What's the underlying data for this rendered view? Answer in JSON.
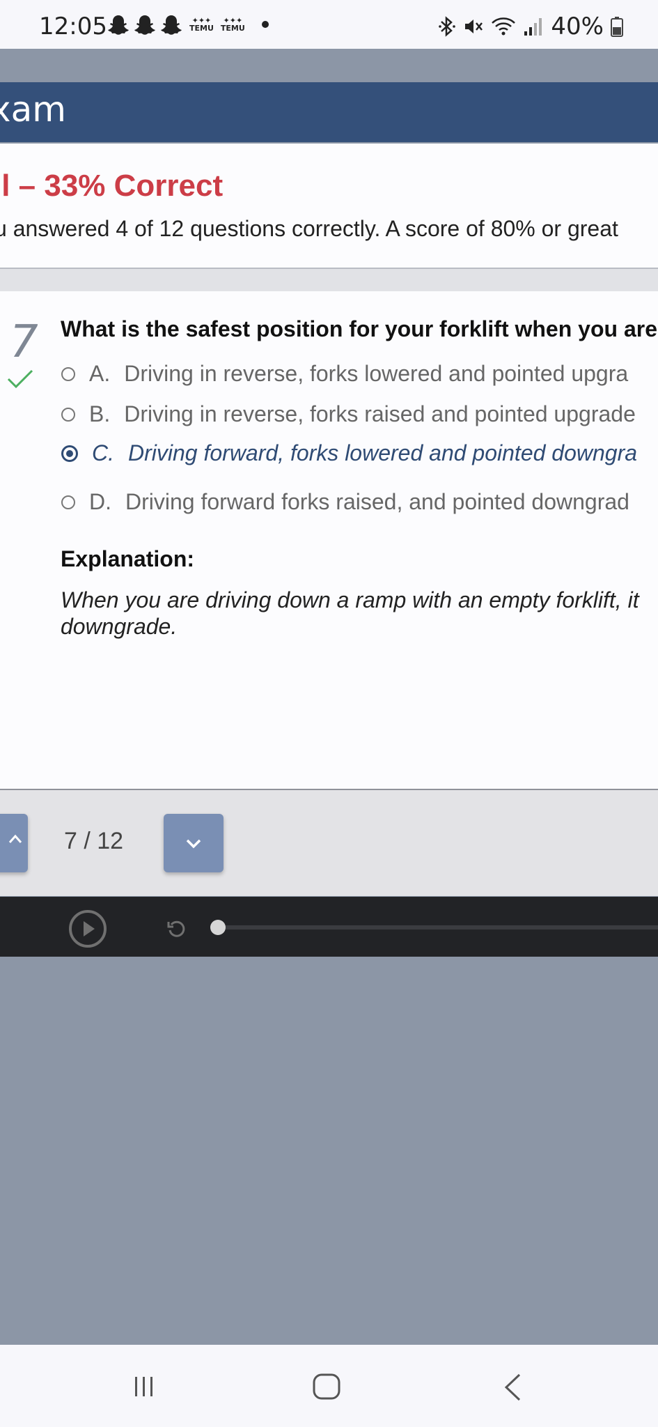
{
  "status_bar": {
    "time": "12:05",
    "notification_icons": [
      "snapchat-icon",
      "snapchat-icon",
      "snapchat-icon",
      "temu-icon",
      "temu-icon"
    ],
    "temu_label": "TEMU",
    "battery": "40%",
    "system_icons": [
      "bluetooth-icon",
      "mute-icon",
      "wifi-icon",
      "signal-icon",
      "battery-icon"
    ]
  },
  "app_header": {
    "title": "xam"
  },
  "result": {
    "title": "il – 33% Correct",
    "subtitle": "u answered 4 of 12 questions correctly. A score of 80% or great",
    "title_color": "#cc3d47"
  },
  "question": {
    "number": "7",
    "status_icon": "check-icon",
    "text": "What is the safest position for your forklift when you are",
    "options": [
      {
        "letter": "A.",
        "text": "Driving in reverse, forks lowered and pointed upgra",
        "selected": false
      },
      {
        "letter": "B.",
        "text": "Driving in reverse, forks raised and pointed upgrade",
        "selected": false
      },
      {
        "letter": "C.",
        "text": "Driving forward, forks lowered and pointed downgra",
        "selected": true
      },
      {
        "letter": "D.",
        "text": "Driving forward forks raised, and pointed downgrad",
        "selected": false
      }
    ],
    "explanation_heading": "Explanation:",
    "explanation_text": "When you are driving down a ramp with an empty forklift, it downgrade."
  },
  "pager": {
    "count": "7 / 12",
    "prev_icon": "chevron-up-icon",
    "next_icon": "chevron-down-icon"
  },
  "media": {
    "play_icon": "play-icon",
    "replay_icon": "replay-icon",
    "progress": 0
  },
  "nav_bar": {
    "icons": [
      "recent-apps-icon",
      "home-icon",
      "back-icon"
    ]
  },
  "colors": {
    "header": "#34507a",
    "accent_button": "#7a8fb4",
    "correct_check": "#4caf60",
    "selected_option": "#2f4b74"
  }
}
